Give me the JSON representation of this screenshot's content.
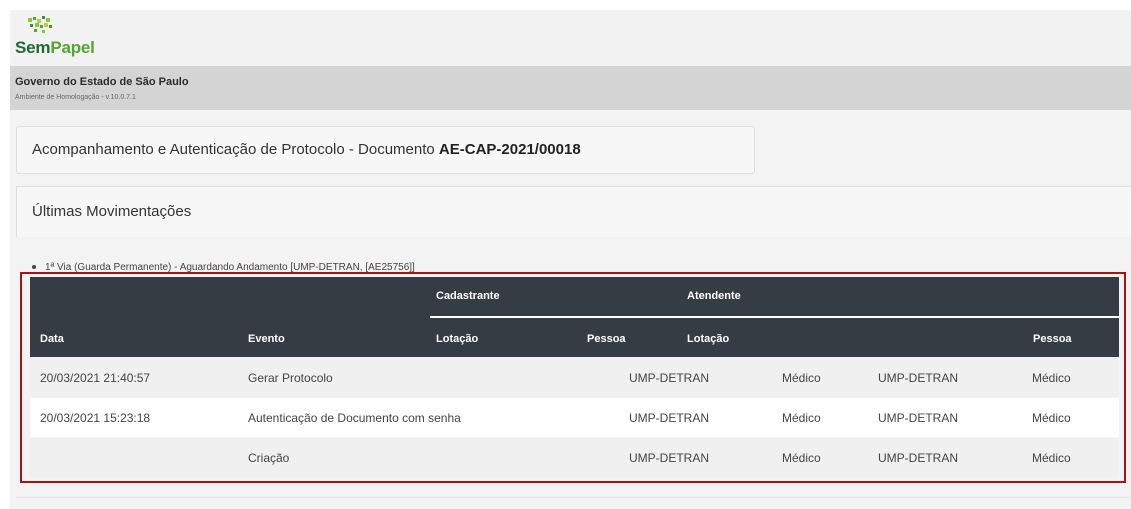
{
  "brand": {
    "logo_text_1": "Sem",
    "logo_text_2": "Papel",
    "icon": "sempapel-logo-icon"
  },
  "header": {
    "org": "Governo do Estado de São Paulo",
    "environment": "Ambiente de Homologação - v.10.0.7.1"
  },
  "doc_title": {
    "prefix": "Acompanhamento e Autenticação de Protocolo - Documento ",
    "code": "AE-CAP-2021/00018"
  },
  "movements": {
    "section_title": "Últimas Movimentações",
    "via_line": "1ª Via (Guarda Permanente) - Aguardando Andamento [UMP-DETRAN, [AE25756]]",
    "groups": {
      "cadastrante": "Cadastrante",
      "atendente": "Atendente"
    },
    "columns": {
      "data": "Data",
      "evento": "Evento",
      "lotacao1": "Lotação",
      "pessoa1": "Pessoa",
      "lotacao2": "Lotação",
      "pessoa2": "Pessoa"
    },
    "rows": [
      {
        "data": "20/03/2021 21:40:57",
        "evento": "Gerar Protocolo",
        "lotacao1": "UMP-DETRAN",
        "pessoa1": "Médico",
        "lotacao2": "UMP-DETRAN",
        "pessoa2": "Médico"
      },
      {
        "data": "20/03/2021 15:23:18",
        "evento": "Autenticação de Documento com senha",
        "lotacao1": "UMP-DETRAN",
        "pessoa1": "Médico",
        "lotacao2": "UMP-DETRAN",
        "pessoa2": "Médico"
      },
      {
        "data": "",
        "evento": "Criação",
        "lotacao1": "UMP-DETRAN",
        "pessoa1": "Médico",
        "lotacao2": "UMP-DETRAN",
        "pessoa2": "Médico"
      }
    ]
  },
  "colors": {
    "header_dark": "#353c43",
    "highlight": "#a31515",
    "brand_green": "#1e6b2f"
  }
}
